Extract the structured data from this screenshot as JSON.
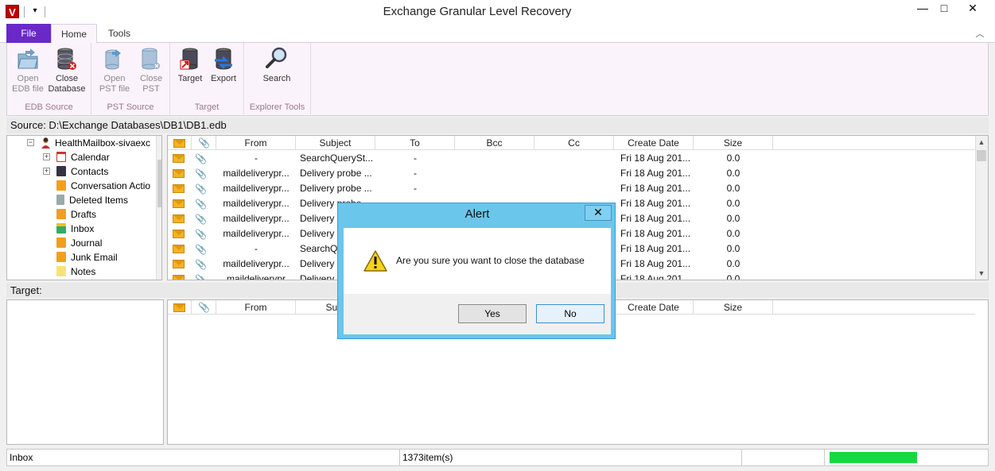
{
  "window": {
    "title": "Exchange Granular Level Recovery",
    "app_icon_letter": "V",
    "minimize": "—",
    "maximize": "□",
    "close": "✕"
  },
  "ribbon": {
    "tabs": [
      "File",
      "Home",
      "Tools"
    ],
    "groups": [
      {
        "label": "EDB Source",
        "buttons": [
          {
            "line1": "Open",
            "line2": "EDB file",
            "icon": "open-edb-icon",
            "enabled": false
          },
          {
            "line1": "Close",
            "line2": "Database",
            "icon": "close-database-icon",
            "enabled": true
          }
        ]
      },
      {
        "label": "PST Source",
        "buttons": [
          {
            "line1": "Open",
            "line2": "PST file",
            "icon": "open-pst-icon",
            "enabled": false
          },
          {
            "line1": "Close",
            "line2": "PST",
            "icon": "close-pst-icon",
            "enabled": false
          }
        ]
      },
      {
        "label": "Target",
        "buttons": [
          {
            "line1": "Target",
            "line2": "",
            "icon": "target-icon",
            "enabled": true
          },
          {
            "line1": "Export",
            "line2": "",
            "icon": "export-icon",
            "enabled": true
          }
        ]
      },
      {
        "label": "Explorer Tools",
        "buttons": [
          {
            "line1": "Search",
            "line2": "",
            "icon": "search-icon",
            "enabled": true
          }
        ]
      }
    ]
  },
  "source_bar": {
    "text": "Source: D:\\Exchange Databases\\DB1\\DB1.edb"
  },
  "tree": {
    "root": "HealthMailbox-sivaexc",
    "items": [
      "Calendar",
      "Contacts",
      "Conversation Actio",
      "Deleted Items",
      "Drafts",
      "Inbox",
      "Journal",
      "Junk Email",
      "Notes"
    ]
  },
  "grid_top": {
    "headers": [
      "From",
      "Subject",
      "To",
      "Bcc",
      "Cc",
      "Create Date",
      "Size"
    ],
    "rows": [
      {
        "from": "-",
        "subject": "SearchQuerySt...",
        "to": "-",
        "date": "Fri 18 Aug 201...",
        "size": "0.0"
      },
      {
        "from": "maildeliverypr...",
        "subject": "Delivery probe ...",
        "to": "-",
        "date": "Fri 18 Aug 201...",
        "size": "0.0"
      },
      {
        "from": "maildeliverypr...",
        "subject": "Delivery probe ...",
        "to": "-",
        "date": "Fri 18 Aug 201...",
        "size": "0.0"
      },
      {
        "from": "maildeliverypr...",
        "subject": "Delivery probe",
        "to": "",
        "date": "Fri 18 Aug 201...",
        "size": "0.0"
      },
      {
        "from": "maildeliverypr...",
        "subject": "Delivery",
        "to": "",
        "date": "Fri 18 Aug 201...",
        "size": "0.0"
      },
      {
        "from": "maildeliverypr...",
        "subject": "Delivery",
        "to": "",
        "date": "Fri 18 Aug 201...",
        "size": "0.0"
      },
      {
        "from": "-",
        "subject": "SearchQ",
        "to": "",
        "date": "Fri 18 Aug 201...",
        "size": "0.0"
      },
      {
        "from": "maildeliverypr...",
        "subject": "Delivery",
        "to": "",
        "date": "Fri 18 Aug 201...",
        "size": "0.0"
      },
      {
        "from": "maildeliverypr",
        "subject": "Delivery",
        "to": "",
        "date": "Fri 18 Aug 201",
        "size": "0.0"
      }
    ]
  },
  "target_bar": {
    "text": "Target:"
  },
  "grid_bottom": {
    "headers": [
      "From",
      "Subj",
      "Create Date",
      "Size"
    ]
  },
  "status": {
    "folder": "Inbox",
    "count": "1373item(s)",
    "progress": 1.0,
    "progress_color": "#18d840"
  },
  "alert": {
    "title": "Alert",
    "close": "✕",
    "message": "Are you sure you want to close the database",
    "yes": "Yes",
    "no": "No"
  },
  "colors": {
    "file_tab": "#6a28c8",
    "ribbon_bg": "#fbf3fb",
    "dialog_frame": "#6bc6ec"
  }
}
